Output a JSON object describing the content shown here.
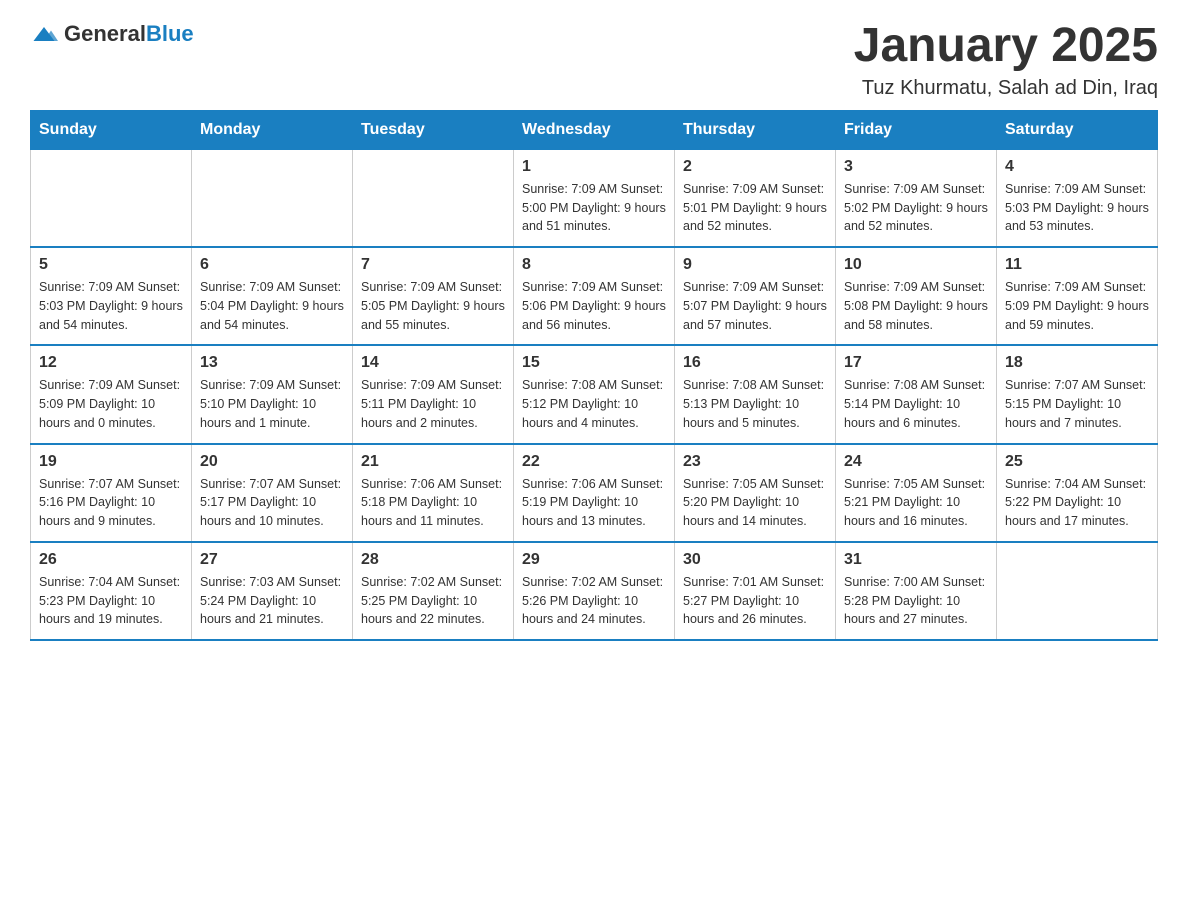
{
  "header": {
    "logo_general": "General",
    "logo_blue": "Blue",
    "title": "January 2025",
    "subtitle": "Tuz Khurmatu, Salah ad Din, Iraq"
  },
  "calendar": {
    "days_of_week": [
      "Sunday",
      "Monday",
      "Tuesday",
      "Wednesday",
      "Thursday",
      "Friday",
      "Saturday"
    ],
    "weeks": [
      [
        {
          "day": "",
          "info": ""
        },
        {
          "day": "",
          "info": ""
        },
        {
          "day": "",
          "info": ""
        },
        {
          "day": "1",
          "info": "Sunrise: 7:09 AM\nSunset: 5:00 PM\nDaylight: 9 hours and 51 minutes."
        },
        {
          "day": "2",
          "info": "Sunrise: 7:09 AM\nSunset: 5:01 PM\nDaylight: 9 hours and 52 minutes."
        },
        {
          "day": "3",
          "info": "Sunrise: 7:09 AM\nSunset: 5:02 PM\nDaylight: 9 hours and 52 minutes."
        },
        {
          "day": "4",
          "info": "Sunrise: 7:09 AM\nSunset: 5:03 PM\nDaylight: 9 hours and 53 minutes."
        }
      ],
      [
        {
          "day": "5",
          "info": "Sunrise: 7:09 AM\nSunset: 5:03 PM\nDaylight: 9 hours and 54 minutes."
        },
        {
          "day": "6",
          "info": "Sunrise: 7:09 AM\nSunset: 5:04 PM\nDaylight: 9 hours and 54 minutes."
        },
        {
          "day": "7",
          "info": "Sunrise: 7:09 AM\nSunset: 5:05 PM\nDaylight: 9 hours and 55 minutes."
        },
        {
          "day": "8",
          "info": "Sunrise: 7:09 AM\nSunset: 5:06 PM\nDaylight: 9 hours and 56 minutes."
        },
        {
          "day": "9",
          "info": "Sunrise: 7:09 AM\nSunset: 5:07 PM\nDaylight: 9 hours and 57 minutes."
        },
        {
          "day": "10",
          "info": "Sunrise: 7:09 AM\nSunset: 5:08 PM\nDaylight: 9 hours and 58 minutes."
        },
        {
          "day": "11",
          "info": "Sunrise: 7:09 AM\nSunset: 5:09 PM\nDaylight: 9 hours and 59 minutes."
        }
      ],
      [
        {
          "day": "12",
          "info": "Sunrise: 7:09 AM\nSunset: 5:09 PM\nDaylight: 10 hours and 0 minutes."
        },
        {
          "day": "13",
          "info": "Sunrise: 7:09 AM\nSunset: 5:10 PM\nDaylight: 10 hours and 1 minute."
        },
        {
          "day": "14",
          "info": "Sunrise: 7:09 AM\nSunset: 5:11 PM\nDaylight: 10 hours and 2 minutes."
        },
        {
          "day": "15",
          "info": "Sunrise: 7:08 AM\nSunset: 5:12 PM\nDaylight: 10 hours and 4 minutes."
        },
        {
          "day": "16",
          "info": "Sunrise: 7:08 AM\nSunset: 5:13 PM\nDaylight: 10 hours and 5 minutes."
        },
        {
          "day": "17",
          "info": "Sunrise: 7:08 AM\nSunset: 5:14 PM\nDaylight: 10 hours and 6 minutes."
        },
        {
          "day": "18",
          "info": "Sunrise: 7:07 AM\nSunset: 5:15 PM\nDaylight: 10 hours and 7 minutes."
        }
      ],
      [
        {
          "day": "19",
          "info": "Sunrise: 7:07 AM\nSunset: 5:16 PM\nDaylight: 10 hours and 9 minutes."
        },
        {
          "day": "20",
          "info": "Sunrise: 7:07 AM\nSunset: 5:17 PM\nDaylight: 10 hours and 10 minutes."
        },
        {
          "day": "21",
          "info": "Sunrise: 7:06 AM\nSunset: 5:18 PM\nDaylight: 10 hours and 11 minutes."
        },
        {
          "day": "22",
          "info": "Sunrise: 7:06 AM\nSunset: 5:19 PM\nDaylight: 10 hours and 13 minutes."
        },
        {
          "day": "23",
          "info": "Sunrise: 7:05 AM\nSunset: 5:20 PM\nDaylight: 10 hours and 14 minutes."
        },
        {
          "day": "24",
          "info": "Sunrise: 7:05 AM\nSunset: 5:21 PM\nDaylight: 10 hours and 16 minutes."
        },
        {
          "day": "25",
          "info": "Sunrise: 7:04 AM\nSunset: 5:22 PM\nDaylight: 10 hours and 17 minutes."
        }
      ],
      [
        {
          "day": "26",
          "info": "Sunrise: 7:04 AM\nSunset: 5:23 PM\nDaylight: 10 hours and 19 minutes."
        },
        {
          "day": "27",
          "info": "Sunrise: 7:03 AM\nSunset: 5:24 PM\nDaylight: 10 hours and 21 minutes."
        },
        {
          "day": "28",
          "info": "Sunrise: 7:02 AM\nSunset: 5:25 PM\nDaylight: 10 hours and 22 minutes."
        },
        {
          "day": "29",
          "info": "Sunrise: 7:02 AM\nSunset: 5:26 PM\nDaylight: 10 hours and 24 minutes."
        },
        {
          "day": "30",
          "info": "Sunrise: 7:01 AM\nSunset: 5:27 PM\nDaylight: 10 hours and 26 minutes."
        },
        {
          "day": "31",
          "info": "Sunrise: 7:00 AM\nSunset: 5:28 PM\nDaylight: 10 hours and 27 minutes."
        },
        {
          "day": "",
          "info": ""
        }
      ]
    ]
  }
}
